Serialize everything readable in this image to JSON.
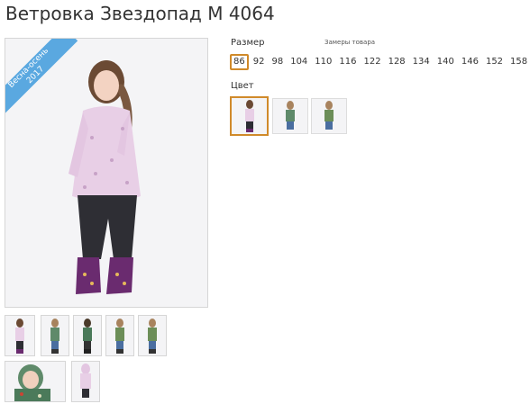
{
  "product": {
    "title": "Ветровка Звездопад М 4064",
    "badge": "Весна-осень",
    "badge_year": "2017"
  },
  "size": {
    "label": "Размер",
    "chart_link": "Замеры товара",
    "options": [
      "86",
      "92",
      "98",
      "104",
      "110",
      "116",
      "122",
      "128",
      "134",
      "140",
      "146",
      "152",
      "158"
    ],
    "selected": "86"
  },
  "color": {
    "label": "Цвет",
    "options": [
      "pink-floral",
      "green-camo",
      "green-camo-alt"
    ],
    "selected": "pink-floral"
  },
  "colors": {
    "accent": "#d08a2a",
    "badge": "#5aa8e0",
    "pink_jacket": "#e8cfe6",
    "green_jacket": "#5f8a6a"
  }
}
